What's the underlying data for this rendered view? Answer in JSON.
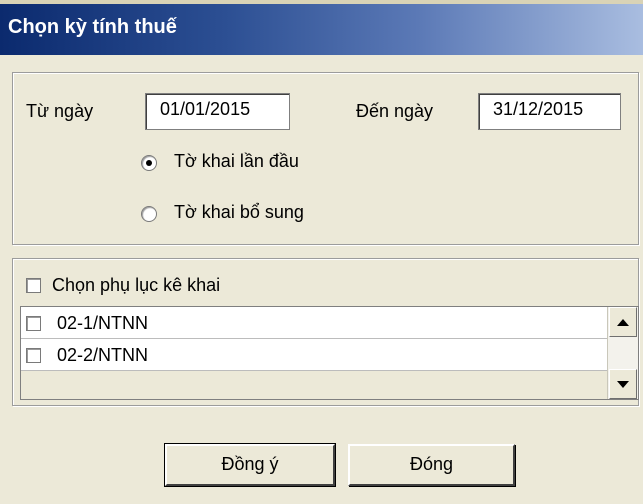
{
  "window": {
    "title": "Chọn kỳ tính thuế"
  },
  "period": {
    "from_label": "Từ ngày",
    "from_value": "01/01/2015",
    "to_label": "Đến ngày",
    "to_value": "31/12/2015"
  },
  "declaration_type": {
    "options": [
      {
        "label": "Tờ khai lần đầu",
        "selected": true
      },
      {
        "label": "Tờ khai bổ sung",
        "selected": false
      }
    ]
  },
  "appendix": {
    "checkbox_label": "Chọn phụ lục kê khai",
    "checked": false,
    "items": [
      {
        "label": "02-1/NTNN",
        "checked": false
      },
      {
        "label": "02-2/NTNN",
        "checked": false
      }
    ]
  },
  "buttons": {
    "ok_label": "Đồng ý",
    "close_label": "Đóng"
  }
}
